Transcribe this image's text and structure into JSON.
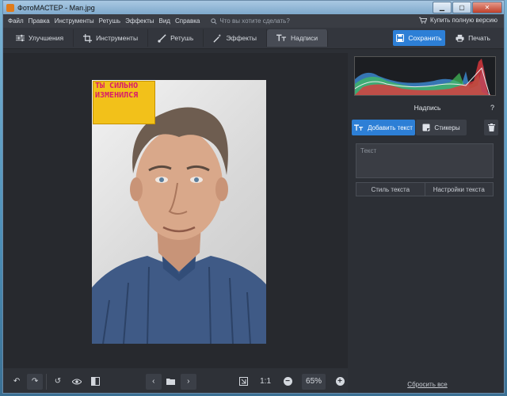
{
  "window": {
    "title": "ФотоМАСТЕР - Man.jpg"
  },
  "menu": {
    "items": [
      "Файл",
      "Правка",
      "Инструменты",
      "Ретушь",
      "Эффекты",
      "Вид",
      "Справка"
    ],
    "search_placeholder": "Что вы хотите сделать?",
    "buy_label": "Купить полную версию"
  },
  "toolbar": {
    "tabs": [
      {
        "label": "Улучшения",
        "icon": "sliders-icon"
      },
      {
        "label": "Инструменты",
        "icon": "crop-icon"
      },
      {
        "label": "Ретушь",
        "icon": "brush-icon"
      },
      {
        "label": "Эффекты",
        "icon": "magic-wand-icon"
      },
      {
        "label": "Надписи",
        "icon": "text-icon",
        "active": true
      }
    ],
    "save_label": "Сохранить",
    "print_label": "Печать"
  },
  "canvas": {
    "sticker_lines": [
      "ТЫ СИЛЬНО",
      "ИЗМЕНИЛСЯ"
    ]
  },
  "panel": {
    "title": "Надпись",
    "help": "?",
    "add_text_label": "Добавить текст",
    "stickers_label": "Стикеры",
    "text_placeholder": "Текст",
    "style_tab": "Стиль текста",
    "settings_tab": "Настройки текста",
    "reset_label": "Сбросить все"
  },
  "bottombar": {
    "ratio_label": "1:1",
    "zoom_level": "65%"
  },
  "colors": {
    "accent": "#2d7fd6",
    "sticker_bg": "#f2c11a",
    "sticker_text": "#d81b6b"
  }
}
